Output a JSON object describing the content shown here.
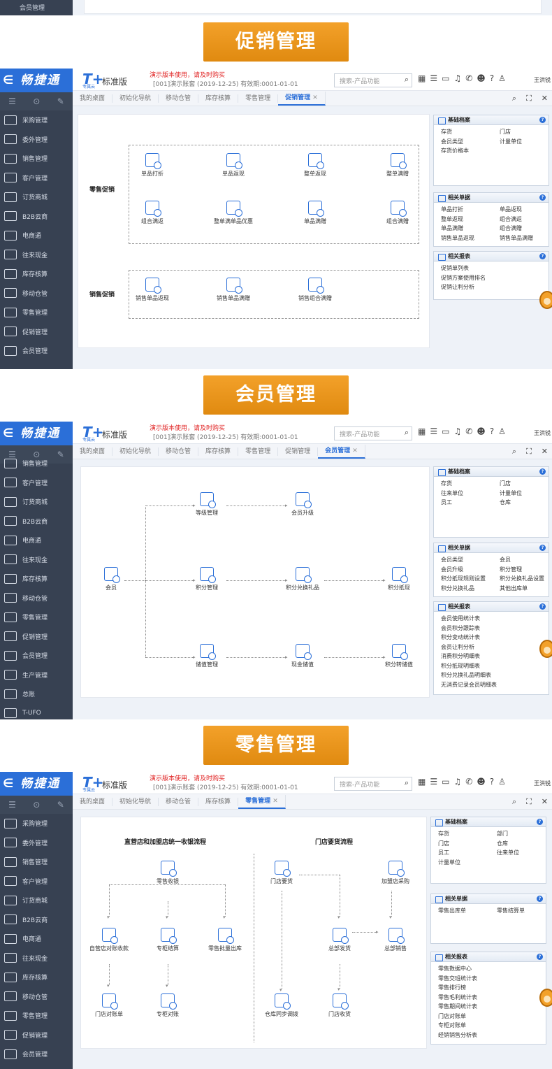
{
  "top_fragment": {
    "label": "会员管理"
  },
  "app": {
    "logo": "畅捷通",
    "brand": "T+",
    "cloud": "专属云",
    "edition": "标准版",
    "warning": "演示版本使用，请及时购买",
    "account": "[001]演示账套  (2019-12-25)  有效期:0001-01-01",
    "search_placeholder": "搜索-产品功能",
    "user": "王洪锐"
  },
  "sections": [
    {
      "title": "促销管理",
      "sidebar": [
        "采购管理",
        "委外管理",
        "销售管理",
        "客户管理",
        "订货商城",
        "B2B云商",
        "电商通",
        "往来现金",
        "库存核算",
        "移动仓管",
        "零售管理",
        "促销管理",
        "会员管理"
      ],
      "tabs": [
        "我的桌面",
        "初始化导航",
        "移动仓管",
        "库存核算",
        "零售管理",
        "促销管理"
      ],
      "groups": [
        {
          "label": "零售促销",
          "items": [
            "单品打折",
            "单品返现",
            "整单返现",
            "整单满赠",
            "组合满返",
            "整单满单品优惠",
            "单品满赠",
            "组合满赠"
          ]
        },
        {
          "label": "销售促销",
          "items": [
            "销售单品返现",
            "销售单品满赠",
            "销售组合满赠"
          ]
        }
      ],
      "panels": [
        {
          "title": "基础档案",
          "left": [
            "存货",
            "会员类型",
            "存货价格本"
          ],
          "right": [
            "门店",
            "计量单位"
          ]
        },
        {
          "title": "相关单据",
          "left": [
            "单品打折",
            "整单返现",
            "单品满赠",
            "销售单品返现"
          ],
          "right": [
            "单品返现",
            "组合满返",
            "组合满赠",
            "销售单品满赠"
          ]
        },
        {
          "title": "相关报表",
          "left": [
            "促销单列表",
            "促销方案使用排名",
            "促销让利分析"
          ],
          "right": []
        }
      ]
    },
    {
      "title": "会员管理",
      "sidebar": [
        "销售管理",
        "客户管理",
        "订货商城",
        "B2B云商",
        "电商通",
        "往来现金",
        "库存核算",
        "移动仓管",
        "零售管理",
        "促销管理",
        "会员管理",
        "生产管理",
        "总账",
        "T-UFO"
      ],
      "tabs": [
        "我的桌面",
        "初始化导航",
        "移动仓管",
        "库存核算",
        "零售管理",
        "促销管理",
        "会员管理"
      ],
      "flow": {
        "member": "会员",
        "row1": [
          "等级管理",
          "会员升级"
        ],
        "row2": [
          "积分管理",
          "积分兑换礼品",
          "积分抵现"
        ],
        "row3": [
          "储值管理",
          "现金储值",
          "积分转储值"
        ]
      },
      "panels": [
        {
          "title": "基础档案",
          "left": [
            "存货",
            "往来单位",
            "员工"
          ],
          "right": [
            "门店",
            "计量单位",
            "仓库"
          ]
        },
        {
          "title": "相关单据",
          "left": [
            "会员类型",
            "会员升级",
            "积分抵现规则设置",
            "积分兑换礼品"
          ],
          "right": [
            "会员",
            "积分管理",
            "积分兑换礼品设置",
            "其他出库单"
          ]
        },
        {
          "title": "相关报表",
          "left": [
            "会员使用统计表",
            "会员积分跟踪表",
            "积分变动统计表",
            "会员让利分析",
            "消费积分明细表",
            "积分抵现明细表",
            "积分兑换礼品明细表",
            "无消费记录会员明细表"
          ],
          "right": []
        }
      ]
    },
    {
      "title": "零售管理",
      "sidebar": [
        "采购管理",
        "委外管理",
        "销售管理",
        "客户管理",
        "订货商城",
        "B2B云商",
        "电商通",
        "往来现金",
        "库存核算",
        "移动仓管",
        "零售管理",
        "促销管理",
        "会员管理"
      ],
      "tabs": [
        "我的桌面",
        "初始化导航",
        "移动仓管",
        "库存核算",
        "零售管理"
      ],
      "flow": {
        "left_title": "直营店和加盟店统一收银流程",
        "right_title": "门店要货流程",
        "pos": "零售收银",
        "row2": [
          "自营店对账收款",
          "专柜结算",
          "零售批量出库"
        ],
        "row3": [
          "门店对账单",
          "专柜对账"
        ],
        "store_req": "门店要货",
        "franchise": "加盟店采购",
        "hq_ship": "总部发货",
        "hq_sale": "总部销售",
        "sync": "仓库同步调拨",
        "receive": "门店收货"
      },
      "panels": [
        {
          "title": "基础档案",
          "left": [
            "存货",
            "门店",
            "员工",
            "计量单位"
          ],
          "right": [
            "部门",
            "仓库",
            "往来单位"
          ]
        },
        {
          "title": "相关单据",
          "left": [
            "零售出库单"
          ],
          "right": [
            "零售结算单"
          ]
        },
        {
          "title": "相关报表",
          "left": [
            "零售数据中心",
            "零售交班统计表",
            "零售排行榜",
            "零售毛利统计表",
            "零售期间统计表",
            "门店对账单",
            "专柜对账单",
            "经销销售分析表"
          ],
          "right": []
        }
      ]
    }
  ]
}
